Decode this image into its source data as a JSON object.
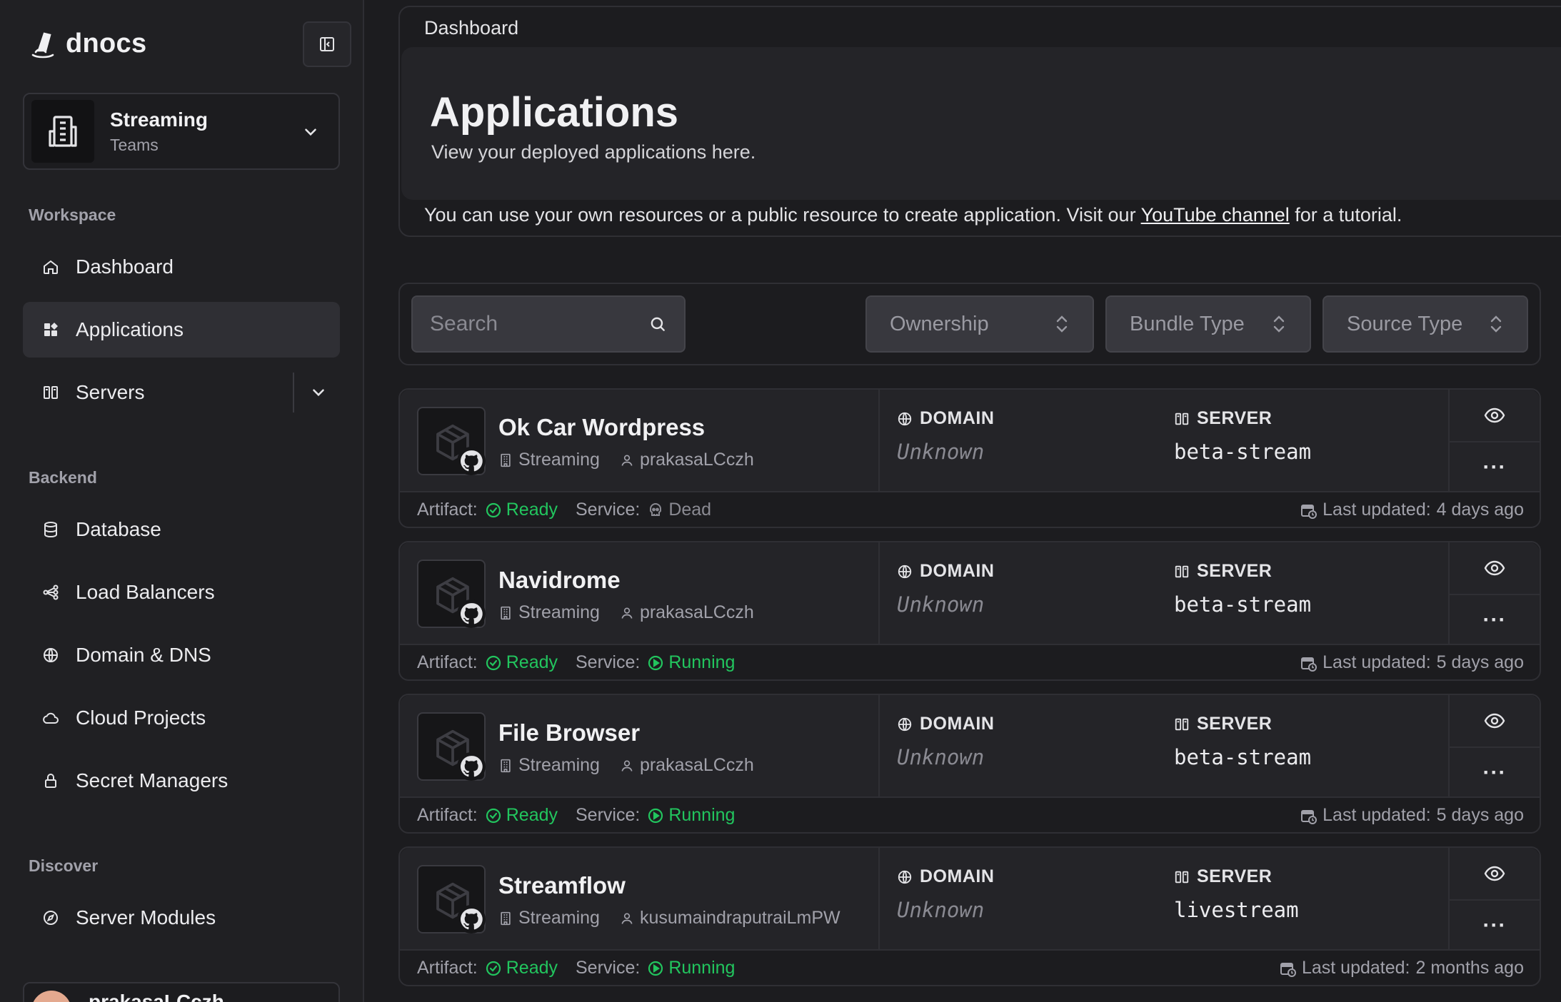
{
  "brand": {
    "name": "dnocs"
  },
  "team": {
    "name": "Streaming",
    "sub": "Teams"
  },
  "sidebar": {
    "sections": [
      "Workspace",
      "Backend",
      "Discover"
    ],
    "items": [
      {
        "label": "Dashboard",
        "icon": "home-icon"
      },
      {
        "label": "Applications",
        "icon": "grid-icon",
        "active": true
      },
      {
        "label": "Servers",
        "icon": "server-icon"
      },
      {
        "label": "Database",
        "icon": "database-icon"
      },
      {
        "label": "Load Balancers",
        "icon": "network-icon"
      },
      {
        "label": "Domain & DNS",
        "icon": "globe-icon"
      },
      {
        "label": "Cloud Projects",
        "icon": "cloud-icon"
      },
      {
        "label": "Secret Managers",
        "icon": "lock-icon"
      },
      {
        "label": "Server Modules",
        "icon": "compass-icon"
      }
    ],
    "user": {
      "name": "prakasaLCczh"
    }
  },
  "header": {
    "breadcrumb": "Dashboard",
    "title": "Applications",
    "subtitle": "View your deployed applications here.",
    "notice_prefix": "You can use your own resources or a public resource to create application. Visit our",
    "notice_link": "YouTube channel",
    "notice_suffix": "for a tutorial."
  },
  "filters": {
    "search_placeholder": "Search",
    "ownership": "Ownership",
    "bundle_type": "Bundle Type",
    "source_type": "Source Type"
  },
  "labels": {
    "domain": "DOMAIN",
    "server": "SERVER",
    "artifact": "Artifact:",
    "service": "Service:",
    "last_updated": "Last updated:"
  },
  "apps": [
    {
      "name": "Ok Car Wordpress",
      "team": "Streaming",
      "owner": "prakasaLCczh",
      "domain": "Unknown",
      "server": "beta-stream",
      "artifact": "Ready",
      "service": "Dead",
      "updated": "4 days ago"
    },
    {
      "name": "Navidrome",
      "team": "Streaming",
      "owner": "prakasaLCczh",
      "domain": "Unknown",
      "server": "beta-stream",
      "artifact": "Ready",
      "service": "Running",
      "updated": "5 days ago"
    },
    {
      "name": "File Browser",
      "team": "Streaming",
      "owner": "prakasaLCczh",
      "domain": "Unknown",
      "server": "beta-stream",
      "artifact": "Ready",
      "service": "Running",
      "updated": "5 days ago"
    },
    {
      "name": "Streamflow",
      "team": "Streaming",
      "owner": "kusumaindraputraiLmPW",
      "domain": "Unknown",
      "server": "livestream",
      "artifact": "Ready",
      "service": "Running",
      "updated": "2 months ago"
    }
  ],
  "colors": {
    "bg": "#1c1c1f",
    "sidebar": "#202023",
    "accent_green": "#22c55e",
    "muted": "#8a8a92"
  }
}
